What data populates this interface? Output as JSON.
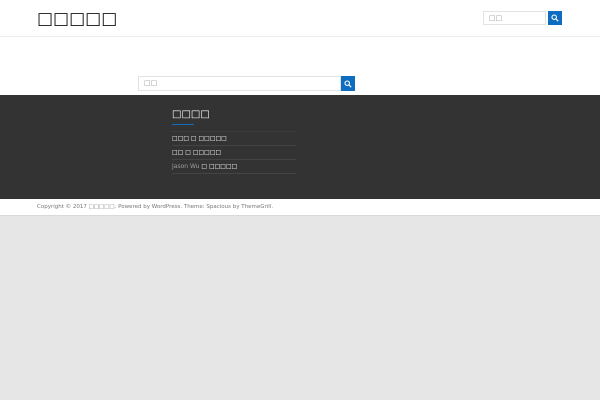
{
  "header": {
    "site_title": "□□□□□",
    "search_placeholder": "□□"
  },
  "content": {
    "search_placeholder": "□□"
  },
  "widget": {
    "title": "□□□□",
    "comments": [
      {
        "author": "□□□",
        "sep": " □ ",
        "post": "□□□□□"
      },
      {
        "author": "□□",
        "sep": " □ ",
        "post": "□□□□□"
      },
      {
        "author": "Jason Wu",
        "sep": " □ ",
        "post": "□□□□□"
      }
    ]
  },
  "footer": {
    "copyright": "Copyright © 2017 □□□□□. Powered by WordPress. Theme: Spacious by ThemeGrill."
  },
  "colors": {
    "accent": "#0f6dc1",
    "footer_bg": "#333333",
    "page_bg": "#e6e6e6"
  },
  "icons": {
    "search": "search-icon"
  }
}
